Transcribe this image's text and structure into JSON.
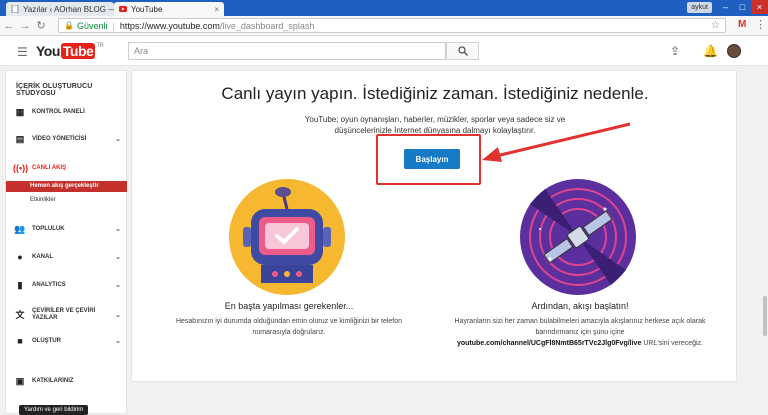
{
  "browser": {
    "tabs": [
      {
        "title": "Yazılar ‹ AOrhan BLOG —",
        "active": false
      },
      {
        "title": "YouTube",
        "active": true
      }
    ],
    "profile": "aykut",
    "omnibox": {
      "secure_label": "Güvenli",
      "host": "https://www.youtube.com",
      "path": "/live_dashboard_splash"
    }
  },
  "header": {
    "logo_you": "You",
    "logo_tube": "Tube",
    "logo_region": "TR",
    "search_placeholder": "Ara"
  },
  "sidebar": {
    "title": "İÇERİK OLUŞTURUCU STÜDYOSU",
    "items": [
      {
        "label": "KONTROL PANELİ",
        "icon": "dashboard-icon"
      },
      {
        "label": "VİDEO YÖNETİCİSİ",
        "icon": "video-manager-icon"
      },
      {
        "label": "CANLI AKIŞ",
        "icon": "live-stream-icon"
      },
      {
        "label": "TOPLULUK",
        "icon": "community-icon"
      },
      {
        "label": "KANAL",
        "icon": "channel-icon"
      },
      {
        "label": "ANALYTICS",
        "icon": "analytics-icon"
      },
      {
        "label": "ÇEVİRİLER VE ÇEVİRİ YAZILAR",
        "icon": "translate-icon"
      },
      {
        "label": "OLUŞTUR",
        "icon": "create-icon"
      },
      {
        "label": "KATKILARINIZ",
        "icon": "contributions-icon"
      }
    ],
    "live_sub": [
      {
        "label": "Hemen akış gerçekleştir",
        "selected": true
      },
      {
        "label": "Etkinlikler",
        "selected": false
      }
    ],
    "tooltip": "Yardım ve geri bildirim"
  },
  "main": {
    "headline": "Canlı yayın yapın. İstediğiniz zaman. İstediğiniz nedenle.",
    "description": "YouTube; oyun oynanışları, haberler, müzikler, sporlar veya sadece siz ve düşüncelerinizle İnternet dünyasına dalmayı kolaylaştırır.",
    "start_button": "Başlayın",
    "left": {
      "title": "En başta yapılması gerekenler...",
      "text": "Hesabınızın iyi durumda olduğundan emin oluruz ve kimliğinizi bir telefon numarasıyla doğrularız."
    },
    "right": {
      "title": "Ardından, akışı başlatın!",
      "text_a": "Hayranların sizi her zaman bulabilmeleri amacıyla akışlarınız herkese açık olarak barındırmanız için şunu içine",
      "url": "youtube.com/channel/UCgFl8NmtB65rTVc2Jlg0Fvg/live",
      "text_b": "URL'sini vereceğiz."
    }
  },
  "colors": {
    "accent": "#167ac6",
    "brand_red": "#e62117",
    "highlight": "#e0332f"
  }
}
